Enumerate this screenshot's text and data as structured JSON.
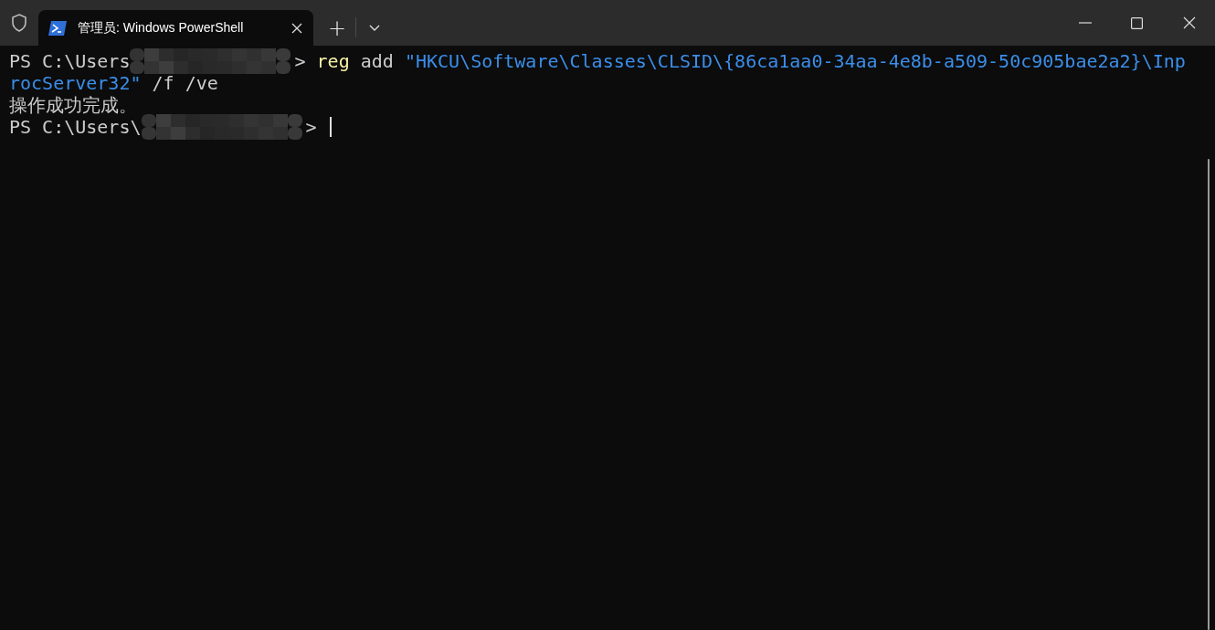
{
  "tabs": [
    {
      "title": "管理员: Windows PowerShell",
      "selected": true
    }
  ],
  "tab_actions": {
    "new_tab": "+"
  },
  "terminal": {
    "lines": [
      [
        {
          "kind": "text",
          "color": "#cccccc",
          "text": "PS C:\\Users"
        },
        {
          "kind": "mosaic"
        },
        {
          "kind": "text",
          "color": "#cccccc",
          "text": "> "
        },
        {
          "kind": "text",
          "color": "#f9f1a5",
          "text": "reg"
        },
        {
          "kind": "text",
          "color": "#cccccc",
          "text": " add "
        },
        {
          "kind": "text",
          "color": "#3b8eea",
          "text": "\"HKCU\\Software\\Classes\\CLSID\\{86ca1aa0-34aa-4e8b-a509-50c905bae2a2}\\Inp"
        }
      ],
      [
        {
          "kind": "text",
          "color": "#3b8eea",
          "text": "rocServer32\""
        },
        {
          "kind": "text",
          "color": "#cccccc",
          "text": " /f /ve"
        }
      ],
      [
        {
          "kind": "text",
          "color": "#cccccc",
          "text": "操作成功完成。"
        }
      ],
      [
        {
          "kind": "text",
          "color": "#cccccc",
          "text": "PS C:\\Users\\"
        },
        {
          "kind": "mosaic"
        },
        {
          "kind": "text",
          "color": "#cccccc",
          "text": "> "
        },
        {
          "kind": "cursor"
        }
      ]
    ]
  }
}
